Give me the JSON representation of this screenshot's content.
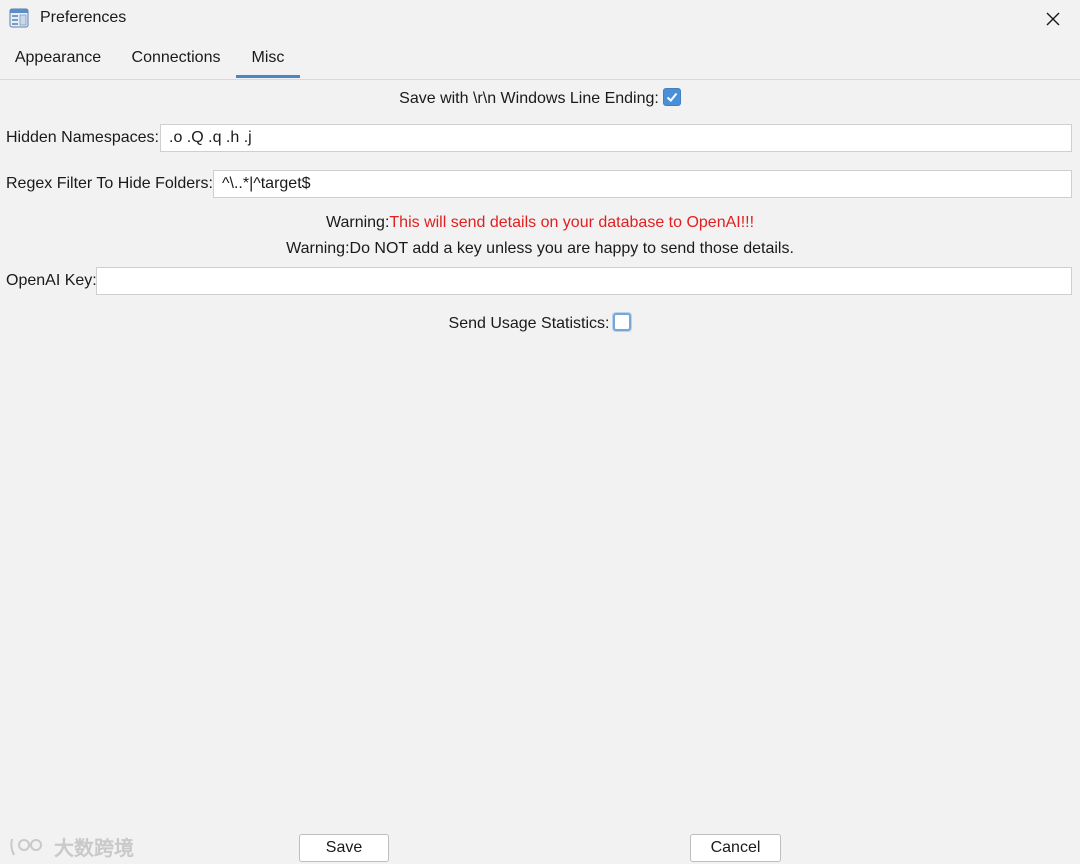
{
  "window": {
    "title": "Preferences",
    "app_icon": "preferences-window-icon",
    "close_icon": "close-icon"
  },
  "tabs": [
    {
      "label": "Appearance",
      "active": false
    },
    {
      "label": "Connections",
      "active": false
    },
    {
      "label": "Misc",
      "active": true
    }
  ],
  "misc": {
    "line_ending_label": "Save with \\r\\n Windows Line Ending:",
    "line_ending_checked": true,
    "hidden_namespaces_label": "Hidden Namespaces:",
    "hidden_namespaces_value": ".o .Q .q .h .j",
    "regex_filter_label": "Regex Filter To Hide Folders:",
    "regex_filter_value": "^\\..*|^target$",
    "warning1_prefix": "Warning:",
    "warning1_text": "This will send details on your database to OpenAI!!!",
    "warning2_text": "Warning:Do NOT add a key unless you are happy to send those details.",
    "openai_key_label": "OpenAI Key:",
    "openai_key_value": "",
    "usage_stats_label": "Send Usage Statistics:",
    "usage_stats_checked": false
  },
  "buttons": {
    "save_label": "Save",
    "cancel_label": "Cancel"
  },
  "watermark": {
    "text": "大数跨境"
  },
  "colors": {
    "accent": "#4a86c8",
    "warning_red": "#e02020",
    "background": "#f2f2f2"
  }
}
